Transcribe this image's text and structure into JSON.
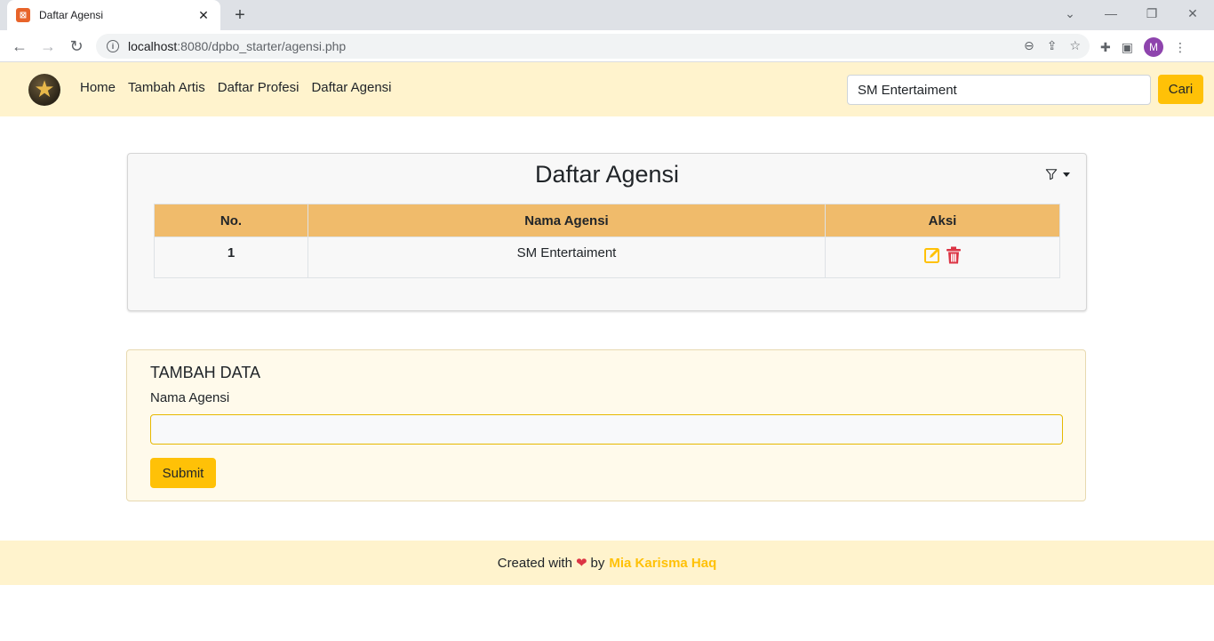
{
  "browser": {
    "tab_title": "Daftar Agensi",
    "url_host": "localhost",
    "url_rest": ":8080/dpbo_starter/agensi.php",
    "profile_initial": "M"
  },
  "navbar": {
    "links": [
      "Home",
      "Tambah Artis",
      "Daftar Profesi",
      "Daftar Agensi"
    ],
    "search_value": "SM Entertaiment",
    "search_button": "Cari"
  },
  "list_card": {
    "title": "Daftar Agensi",
    "headers": [
      "No.",
      "Nama Agensi",
      "Aksi"
    ],
    "rows": [
      {
        "no": "1",
        "nama": "SM Entertaiment"
      }
    ]
  },
  "form_card": {
    "heading": "TAMBAH DATA",
    "label": "Nama Agensi",
    "input_value": "",
    "submit_label": "Submit"
  },
  "footer": {
    "prefix": "Created with",
    "by": "by",
    "author": "Mia Karisma Haq"
  },
  "colors": {
    "accent": "#ffc107",
    "navbar_bg": "#fff3cd",
    "table_header_bg": "#f0bb6b",
    "danger": "#dc3545"
  }
}
